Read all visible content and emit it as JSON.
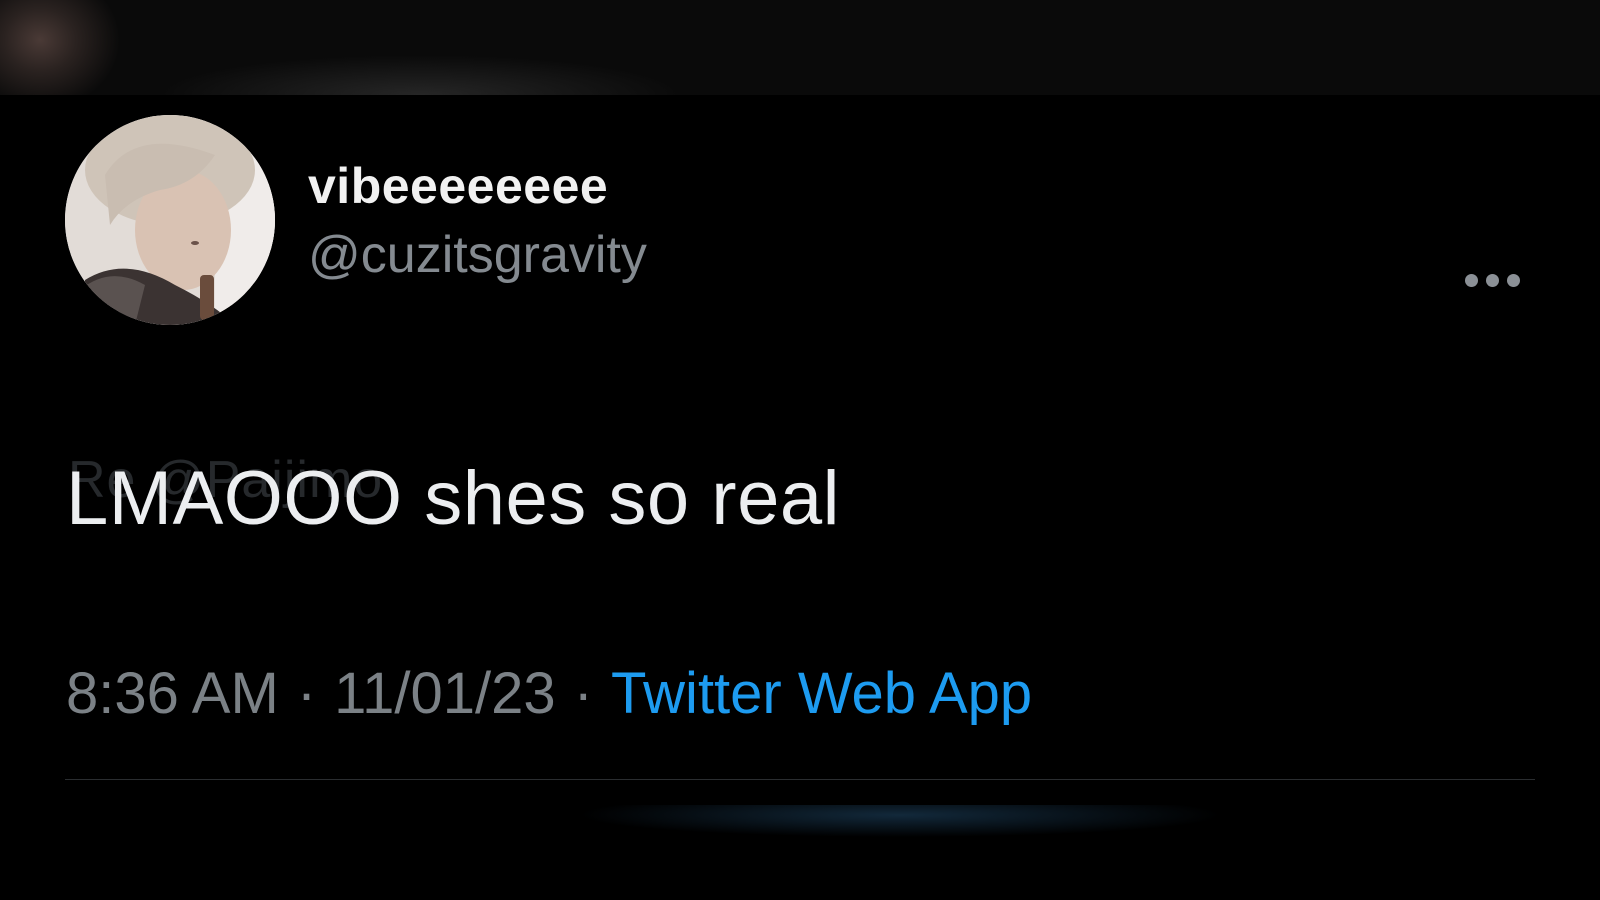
{
  "tweet": {
    "author": {
      "display_name": "vibeeeeeeee",
      "handle": "@cuzitsgravity",
      "avatar": "profile-photo"
    },
    "reply_context": "Re              @Pajjimo",
    "text": "LMAOOO shes so real",
    "time": "8:36 AM",
    "separator": "·",
    "date": "11/01/23",
    "source": "Twitter Web App",
    "more_icon": "more-horizontal-icon"
  },
  "colors": {
    "background": "#000000",
    "primary_text": "#eceef0",
    "secondary_text": "#7b8186",
    "link": "#1d9bf0"
  }
}
